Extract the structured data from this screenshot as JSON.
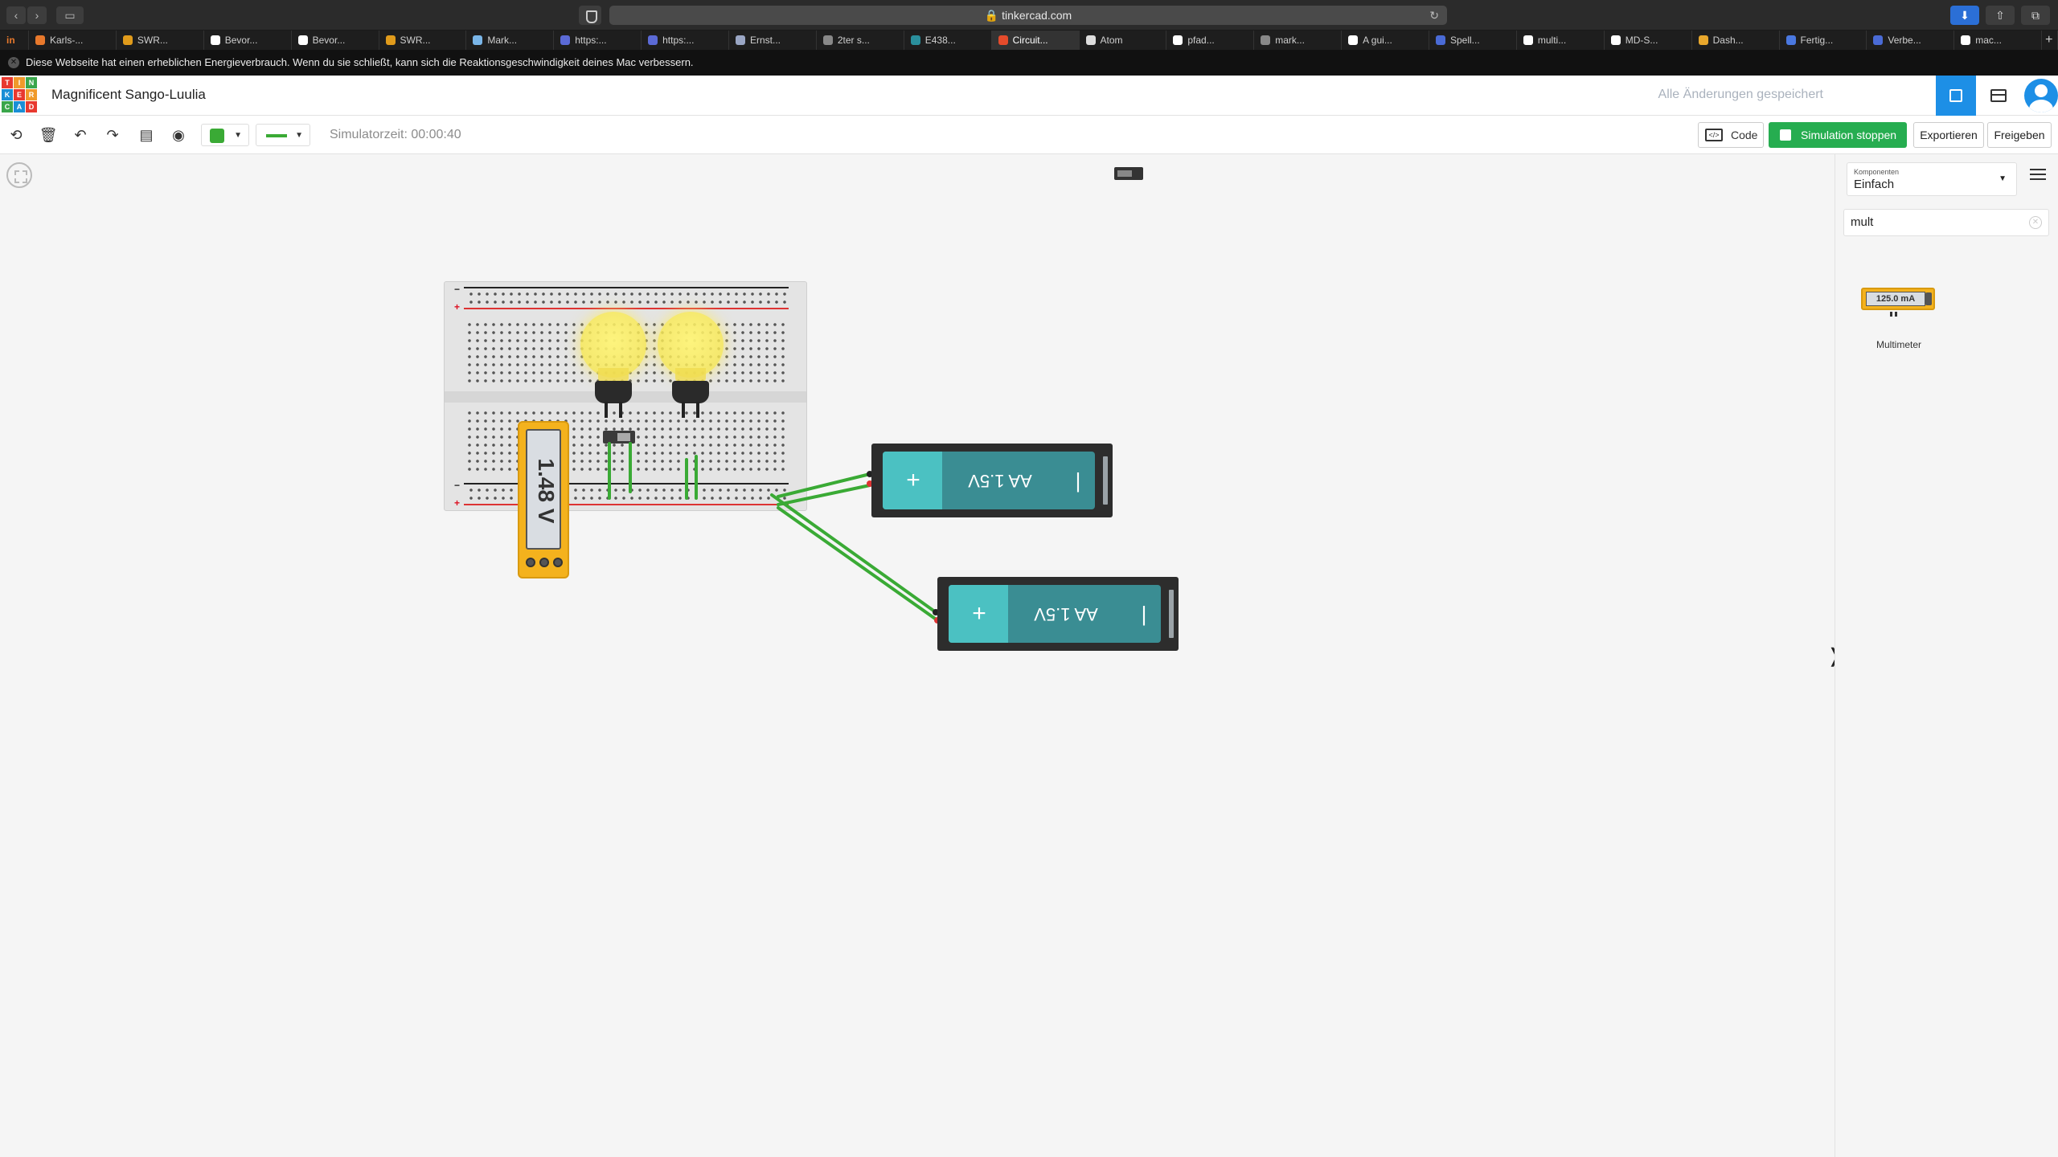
{
  "browser": {
    "url": "tinkercad.com",
    "tabs": [
      {
        "label": "in"
      },
      {
        "label": "Karls-..."
      },
      {
        "label": "SWR..."
      },
      {
        "label": "Bevor..."
      },
      {
        "label": "Bevor..."
      },
      {
        "label": "SWR..."
      },
      {
        "label": "Mark..."
      },
      {
        "label": "https:..."
      },
      {
        "label": "https:..."
      },
      {
        "label": "Ernst..."
      },
      {
        "label": "2ter s..."
      },
      {
        "label": "E438..."
      },
      {
        "label": "Circuit..."
      },
      {
        "label": "Atom"
      },
      {
        "label": "pfad..."
      },
      {
        "label": "mark..."
      },
      {
        "label": "A gui..."
      },
      {
        "label": "Spell..."
      },
      {
        "label": "multi..."
      },
      {
        "label": "MD-S..."
      },
      {
        "label": "Dash..."
      },
      {
        "label": "Fertig..."
      },
      {
        "label": "Verbe..."
      },
      {
        "label": "mac..."
      }
    ],
    "add_tab": "+"
  },
  "notice": {
    "text": "Diese Webseite hat einen erheblichen Energieverbrauch. Wenn du sie schließt, kann sich die Reaktionsgeschwindigkeit deines Mac verbessern."
  },
  "header": {
    "logo_letters": [
      "T",
      "I",
      "N",
      "K",
      "E",
      "R",
      "C",
      "A",
      "D"
    ],
    "project_name": "Magnificent Sango-Luulia",
    "save_status": "Alle Änderungen gespeichert"
  },
  "toolbar": {
    "sim_time": "Simulatorzeit: 00:00:40",
    "code_label": "Code",
    "stop_label": "Simulation stoppen",
    "export_label": "Exportieren",
    "share_label": "Freigeben",
    "wire_color": "#3aaa35"
  },
  "canvas": {
    "multimeter_reading": "1.48 V",
    "batteries": [
      {
        "label": "AA 1.5V"
      },
      {
        "label": "AA 1.5V"
      }
    ]
  },
  "panel": {
    "components_label": "Komponenten",
    "components_value": "Einfach",
    "search_value": "mult",
    "items": [
      {
        "name": "Multimeter",
        "reading": "125.0 mA"
      }
    ]
  }
}
